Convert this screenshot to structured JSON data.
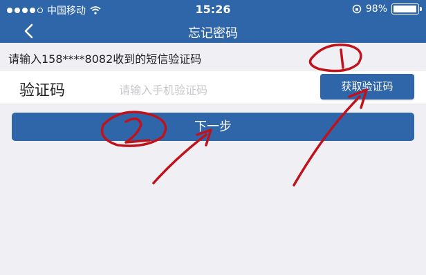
{
  "status": {
    "carrier": "中国移动",
    "time": "15:26",
    "battery_text": "98%",
    "battery_level": 0.98
  },
  "nav": {
    "title": "忘记密码"
  },
  "hint": "请输入158****8082收到的短信验证码",
  "form": {
    "label": "验证码",
    "placeholder": "请输入手机验证码",
    "get_code_label": "获取验证码"
  },
  "next_label": "下一步",
  "colors": {
    "brand_blue": "#2f66a9",
    "annotation_red": "#c0121a",
    "background": "#efeff4"
  },
  "icons": {
    "back": "chevron-left-icon",
    "wifi": "wifi-icon",
    "lock_rotation": "rotation-lock-icon",
    "battery": "battery-icon"
  }
}
